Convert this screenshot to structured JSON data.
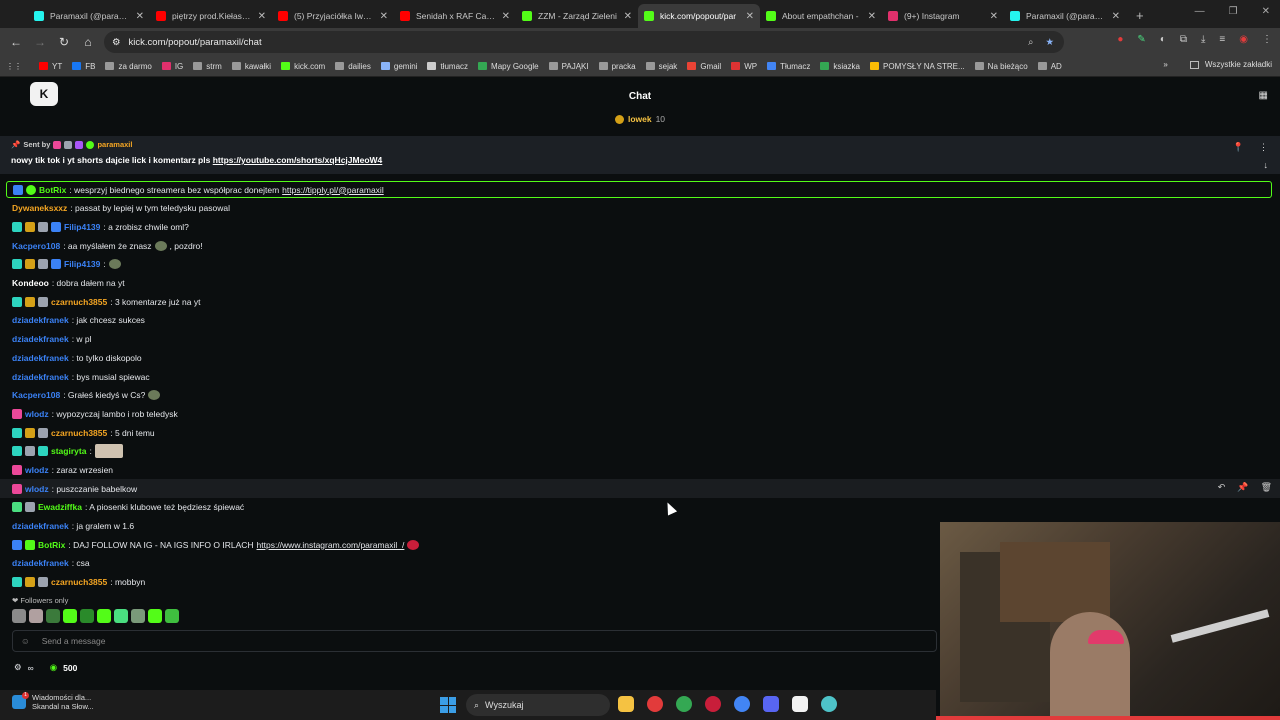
{
  "browser": {
    "tabs": [
      {
        "title": "Paramaxil (@paramax",
        "color": "#25f4ee"
      },
      {
        "title": "piętrzy prod.Kiełas - Y",
        "color": "#ff0000"
      },
      {
        "title": "(5) Przyjaciółka Iwony",
        "color": "#ff0000"
      },
      {
        "title": "Senidah x RAF Camo",
        "color": "#ff0000"
      },
      {
        "title": "ZZM - Zarząd Zieleni",
        "color": "#53fc18"
      },
      {
        "title": "kick.com/popout/par",
        "color": "#53fc18",
        "active": true
      },
      {
        "title": "About empathchan -",
        "color": "#53fc18"
      },
      {
        "title": "(9+) Instagram",
        "color": "#e1306c"
      },
      {
        "title": "Paramaxil (@paramax",
        "color": "#25f4ee"
      }
    ],
    "url": "kick.com/popout/paramaxil/chat",
    "bookmarks": [
      {
        "label": "YT",
        "color": "#ff0000"
      },
      {
        "label": "FB",
        "color": "#1877f2"
      },
      {
        "label": "za darmo",
        "color": "#999"
      },
      {
        "label": "IG",
        "color": "#e1306c"
      },
      {
        "label": "strm",
        "color": "#999"
      },
      {
        "label": "kawałki",
        "color": "#999"
      },
      {
        "label": "kick.com",
        "color": "#53fc18"
      },
      {
        "label": "dailies",
        "color": "#999"
      },
      {
        "label": "gemini",
        "color": "#8ab4f8"
      },
      {
        "label": "tłumacz",
        "color": "#ccc"
      },
      {
        "label": "Mapy Google",
        "color": "#34a853"
      },
      {
        "label": "PAJĄKI",
        "color": "#999"
      },
      {
        "label": "pracka",
        "color": "#999"
      },
      {
        "label": "sejak",
        "color": "#999"
      },
      {
        "label": "Gmail",
        "color": "#ea4335"
      },
      {
        "label": "WP",
        "color": "#d33"
      },
      {
        "label": "Tłumacz",
        "color": "#4285f4"
      },
      {
        "label": "ksiazka",
        "color": "#34a853"
      },
      {
        "label": "POMYSŁY NA STRE...",
        "color": "#fbbc05"
      },
      {
        "label": "Na bieżąco",
        "color": "#999"
      },
      {
        "label": "AD",
        "color": "#999"
      }
    ],
    "all_bookmarks": "Wszystkie zakładki"
  },
  "chat": {
    "title": "Chat",
    "gift_user": "lowek",
    "gift_count": "10",
    "pinned": {
      "sent_by": "Sent by",
      "username": "paramaxil",
      "text": "nowy tik tok i yt shorts dajcie lick i komentarz pls",
      "link": "https://youtube.com/shorts/xqHcjJMeoW4"
    },
    "bot_banner": {
      "user": "BotRix",
      "text": ": wesprzyj biednego streamera bez współprac donejtem",
      "link": "https://tipply.pl/@paramaxil"
    },
    "messages": [
      {
        "user": "Dywaneksxxz",
        "color": "#f5a623",
        "text": ": passat by lepiej w tym teledysku pasowal",
        "badges": []
      },
      {
        "user": "Filip4139",
        "color": "#3b82f6",
        "text": ": a zrobisz chwile oml?",
        "badges": [
          "#2dd4bf",
          "#d4a017",
          "#9ca3af",
          "#3b82f6"
        ]
      },
      {
        "user": "Kacpero108",
        "color": "#3b82f6",
        "text": ": aa myślałem że znasz",
        "after": ", pozdro!",
        "emote": true,
        "badges": []
      },
      {
        "user": "Filip4139",
        "color": "#3b82f6",
        "text": ":",
        "emote": true,
        "badges": [
          "#2dd4bf",
          "#d4a017",
          "#9ca3af",
          "#3b82f6"
        ]
      },
      {
        "user": "Kondeoo",
        "color": "#ffffff",
        "text": ": dobra dałem na yt",
        "badges": []
      },
      {
        "user": "czarnuch3855",
        "color": "#f5a623",
        "text": ": 3 komentarze już na yt",
        "badges": [
          "#2dd4bf",
          "#d4a017",
          "#9ca3af"
        ]
      },
      {
        "user": "dziadekfranek",
        "color": "#3b82f6",
        "text": ": jak chcesz sukces",
        "badges": []
      },
      {
        "user": "dziadekfranek",
        "color": "#3b82f6",
        "text": ": w pl",
        "badges": []
      },
      {
        "user": "dziadekfranek",
        "color": "#3b82f6",
        "text": ": to tylko diskopolo",
        "badges": []
      },
      {
        "user": "dziadekfranek",
        "color": "#3b82f6",
        "text": ": bys musial spiewac",
        "badges": []
      },
      {
        "user": "Kacpero108",
        "color": "#3b82f6",
        "text": ": Grałeś kiedyś w Cs?",
        "emote": true,
        "badges": []
      },
      {
        "user": "wlodz",
        "color": "#3b82f6",
        "text": ": wypozyczaj lambo i rob teledysk",
        "badges": [
          "#ec4899"
        ]
      },
      {
        "user": "czarnuch3855",
        "color": "#f5a623",
        "text": ": 5 dni temu",
        "badges": [
          "#2dd4bf",
          "#d4a017",
          "#9ca3af"
        ]
      },
      {
        "user": "stagiryta",
        "color": "#53fc18",
        "text": ":",
        "emote2": true,
        "badges": [
          "#2dd4bf",
          "#9ca3af",
          "#2dd4bf"
        ]
      },
      {
        "user": "wlodz",
        "color": "#3b82f6",
        "text": ": zaraz wrzesien",
        "badges": [
          "#ec4899"
        ]
      },
      {
        "user": "wlodz",
        "color": "#3b82f6",
        "text": ": puszczanie babelkow",
        "badges": [
          "#ec4899"
        ],
        "hl": true
      },
      {
        "user": "Ewadziffka",
        "color": "#53fc18",
        "text": ": A piosenki klubowe też będziesz śpiewać",
        "badges": [
          "#4ade80",
          "#9ca3af"
        ]
      },
      {
        "user": "dziadekfranek",
        "color": "#3b82f6",
        "text": ": ja gralem w 1.6",
        "badges": []
      },
      {
        "user": "BotRix",
        "color": "#53fc18",
        "text": ": DAJ FOLLOW NA IG - NA IGS INFO O IRLACH",
        "link": "https://www.instagram.com/paramaxil_/",
        "badges": [
          "#3b82f6",
          "#53fc18"
        ]
      },
      {
        "user": "dziadekfranek",
        "color": "#3b82f6",
        "text": ": csa",
        "badges": []
      },
      {
        "user": "czarnuch3855",
        "color": "#f5a623",
        "text": ": mobbyn",
        "badges": [
          "#2dd4bf",
          "#d4a017",
          "#9ca3af"
        ]
      }
    ],
    "followers_only": "Followers only",
    "input_placeholder": "Send a message",
    "points": "500"
  },
  "taskbar": {
    "notify_title": "Wiadomości dla...",
    "notify_sub": "Skandal na Słow...",
    "notify_badge": "1",
    "search": "Wyszukaj"
  }
}
